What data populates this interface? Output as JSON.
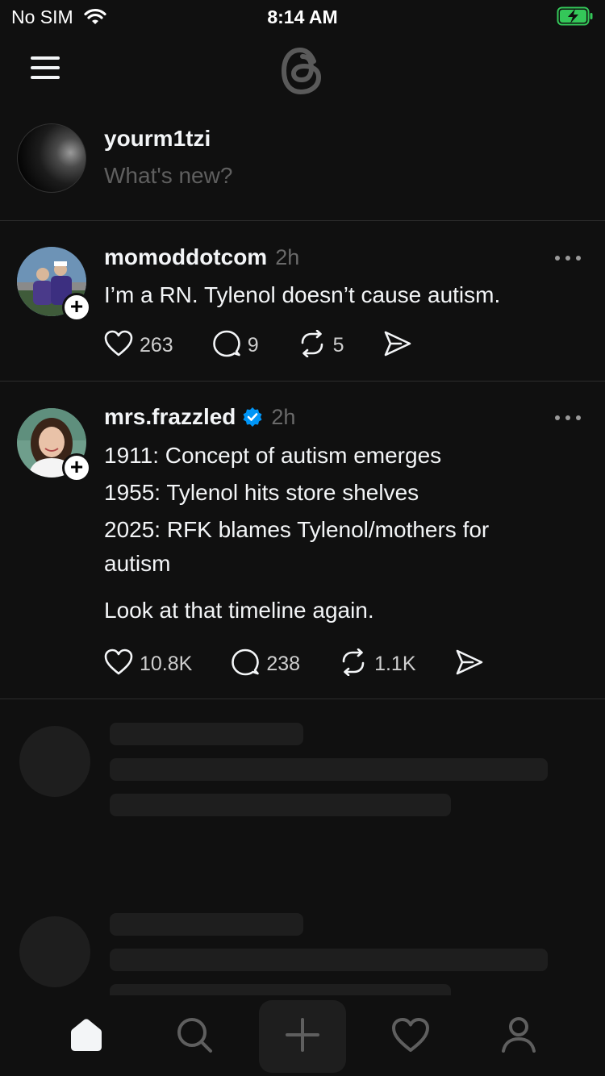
{
  "status_bar": {
    "carrier": "No SIM",
    "time": "8:14 AM"
  },
  "composer": {
    "username": "yourm1tzi",
    "placeholder": "What's new?"
  },
  "posts": [
    {
      "username": "momoddotcom",
      "time": "2h",
      "verified": false,
      "text_lines": [
        "I’m a RN. Tylenol doesn’t cause autism."
      ],
      "likes": "263",
      "replies": "9",
      "reposts": "5"
    },
    {
      "username": "mrs.frazzled",
      "time": "2h",
      "verified": true,
      "text_lines": [
        "1911: Concept of autism emerges",
        "1955: Tylenol hits store shelves",
        "2025: RFK blames Tylenol/mothers for",
        "autism",
        "Look at that timeline again."
      ],
      "likes": "10.8K",
      "replies": "238",
      "reposts": "1.1K"
    }
  ],
  "tabs": [
    "home-icon",
    "search-icon",
    "create-icon",
    "activity-heart-icon",
    "profile-icon"
  ],
  "colors": {
    "background": "#101010",
    "text": "#f3f5f7",
    "muted": "#6a6a6a",
    "verified": "#0095f6",
    "battery": "#34c759",
    "skeleton": "#1e1e1e"
  }
}
